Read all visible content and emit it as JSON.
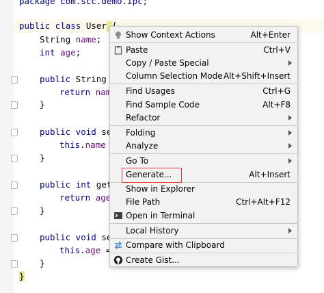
{
  "editor": {
    "lines": [
      {
        "text_plain": "package com.scc.demo.ipc;"
      },
      {
        "kw": "public class",
        "plain": " User {"
      },
      {
        "type": "String",
        "field": "name",
        "end": ";"
      },
      {
        "kw": "int",
        "field": "age",
        "end": ";"
      },
      {
        "kw": "public",
        "plain": " String"
      },
      {
        "kw": "return",
        "field": "nam"
      },
      {
        "plain": "}"
      },
      {
        "kw": "public void",
        "plain": " se"
      },
      {
        "kw": "this",
        "plain": ".",
        "field": "name"
      },
      {
        "plain": "}"
      },
      {
        "kw": "public int",
        "plain": " get"
      },
      {
        "kw": "return",
        "field": "age"
      },
      {
        "plain": "}"
      },
      {
        "kw": "public void",
        "plain": " se"
      },
      {
        "kw": "this",
        "plain": ".",
        "field": "age",
        "end": " ="
      },
      {
        "plain": "}"
      },
      {
        "plain": "}"
      }
    ]
  },
  "context_menu": {
    "items": [
      {
        "label": "Show Context Actions",
        "shortcut": "Alt+Enter",
        "icon": "lightbulb-icon"
      },
      {
        "label": "Paste",
        "shortcut": "Ctrl+V",
        "icon": "clipboard-icon"
      },
      {
        "label": "Copy / Paste Special",
        "submenu": true
      },
      {
        "label": "Column Selection Mode",
        "shortcut": "Alt+Shift+Insert"
      },
      {
        "label": "Find Usages",
        "shortcut": "Ctrl+G"
      },
      {
        "label": "Find Sample Code",
        "shortcut": "Alt+F8"
      },
      {
        "label": "Refactor",
        "submenu": true
      },
      {
        "label": "Folding",
        "submenu": true
      },
      {
        "label": "Analyze",
        "submenu": true
      },
      {
        "label": "Go To",
        "submenu": true
      },
      {
        "label": "Generate...",
        "shortcut": "Alt+Insert",
        "highlighted": true
      },
      {
        "label": "Show in Explorer"
      },
      {
        "label": "File Path",
        "shortcut": "Ctrl+Alt+F12"
      },
      {
        "label": "Open in Terminal",
        "icon": "terminal-icon"
      },
      {
        "label": "Local History",
        "submenu": true
      },
      {
        "label": "Compare with Clipboard",
        "icon": "compare-icon"
      },
      {
        "label": "Create Gist...",
        "icon": "github-icon"
      }
    ]
  },
  "colors": {
    "keyword": "#000080",
    "field": "#660e7a",
    "menu_bg": "#f2f2f2",
    "highlight_box": "#e53935"
  }
}
